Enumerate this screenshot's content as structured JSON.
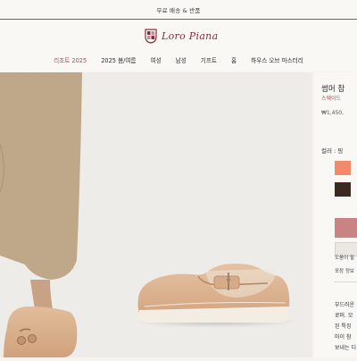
{
  "topbar": {
    "promo": "무료 배송 & 반품"
  },
  "brand": {
    "logo_text": "Loro Piana"
  },
  "nav": {
    "items": [
      {
        "label": "리조트 2025",
        "active": true
      },
      {
        "label": "2025 봄/여름",
        "active": false
      },
      {
        "label": "여성",
        "active": false
      },
      {
        "label": "남성",
        "active": false
      },
      {
        "label": "기프트",
        "active": false
      },
      {
        "label": "홈",
        "active": false
      },
      {
        "label": "하우스 오브 마스터리",
        "active": false
      }
    ]
  },
  "product": {
    "name": "썸머 참",
    "material": "스웨이드",
    "price": "₩1,450,",
    "color_label": "컬러 : 핑",
    "swatches": [
      "#f08a6a",
      "#e7dfd6",
      "#3b2a22",
      "#ece8e2"
    ],
    "help_text": "도움이 필",
    "packaging_text": "포장 정보",
    "description_lines": [
      "부드러운",
      "로퍼. 모",
      "된 특징",
      "마이 참",
      "보내는 디"
    ]
  },
  "colors": {
    "accent": "#b9434f",
    "logo": "#8e2b3a",
    "cta": "#c98383"
  }
}
